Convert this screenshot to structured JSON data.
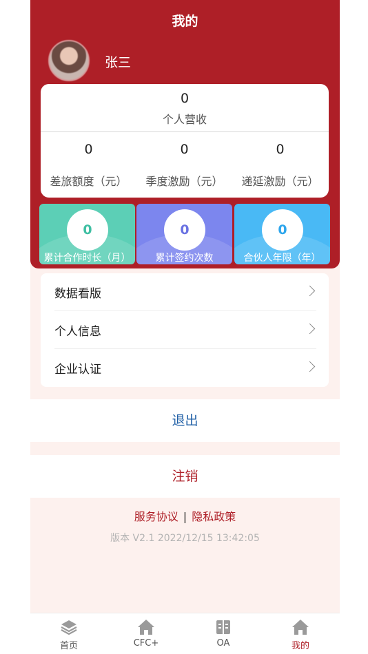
{
  "header": {
    "title": "我的"
  },
  "profile": {
    "name": "张三"
  },
  "stats": {
    "revenue": {
      "value": "0",
      "label": "个人营收"
    },
    "columns": [
      {
        "value": "0",
        "label": "差旅额度（元）"
      },
      {
        "value": "0",
        "label": "季度激励（元）"
      },
      {
        "value": "0",
        "label": "递延激励（元）"
      }
    ]
  },
  "tiles": [
    {
      "value": "0",
      "label": "累计合作时长（月）",
      "bg": "#5ccfb6",
      "accent": "#3fbfa3"
    },
    {
      "value": "0",
      "label": "累计签约次数",
      "bg": "#7c86ee",
      "accent": "#6a72e2"
    },
    {
      "value": "0",
      "label": "合伙人年限（年）",
      "bg": "#49b9f5",
      "accent": "#2ea6ec"
    }
  ],
  "menu": [
    {
      "label": "数据看版"
    },
    {
      "label": "个人信息"
    },
    {
      "label": "企业认证"
    }
  ],
  "actions": {
    "logout": "退出",
    "cancel": "注销"
  },
  "footer": {
    "service_agreement": "服务协议",
    "separator": "|",
    "privacy_policy": "隐私政策",
    "version": "版本 V2.1 2022/12/15 13:42:05"
  },
  "tabbar": [
    {
      "label": "首页",
      "icon": "layers-icon"
    },
    {
      "label": "CFC+",
      "icon": "home-icon"
    },
    {
      "label": "OA",
      "icon": "document-icon"
    },
    {
      "label": "我的",
      "icon": "home-icon",
      "active": true
    }
  ],
  "colors": {
    "brand": "#ae1f27",
    "link": "#1f5fa6"
  }
}
